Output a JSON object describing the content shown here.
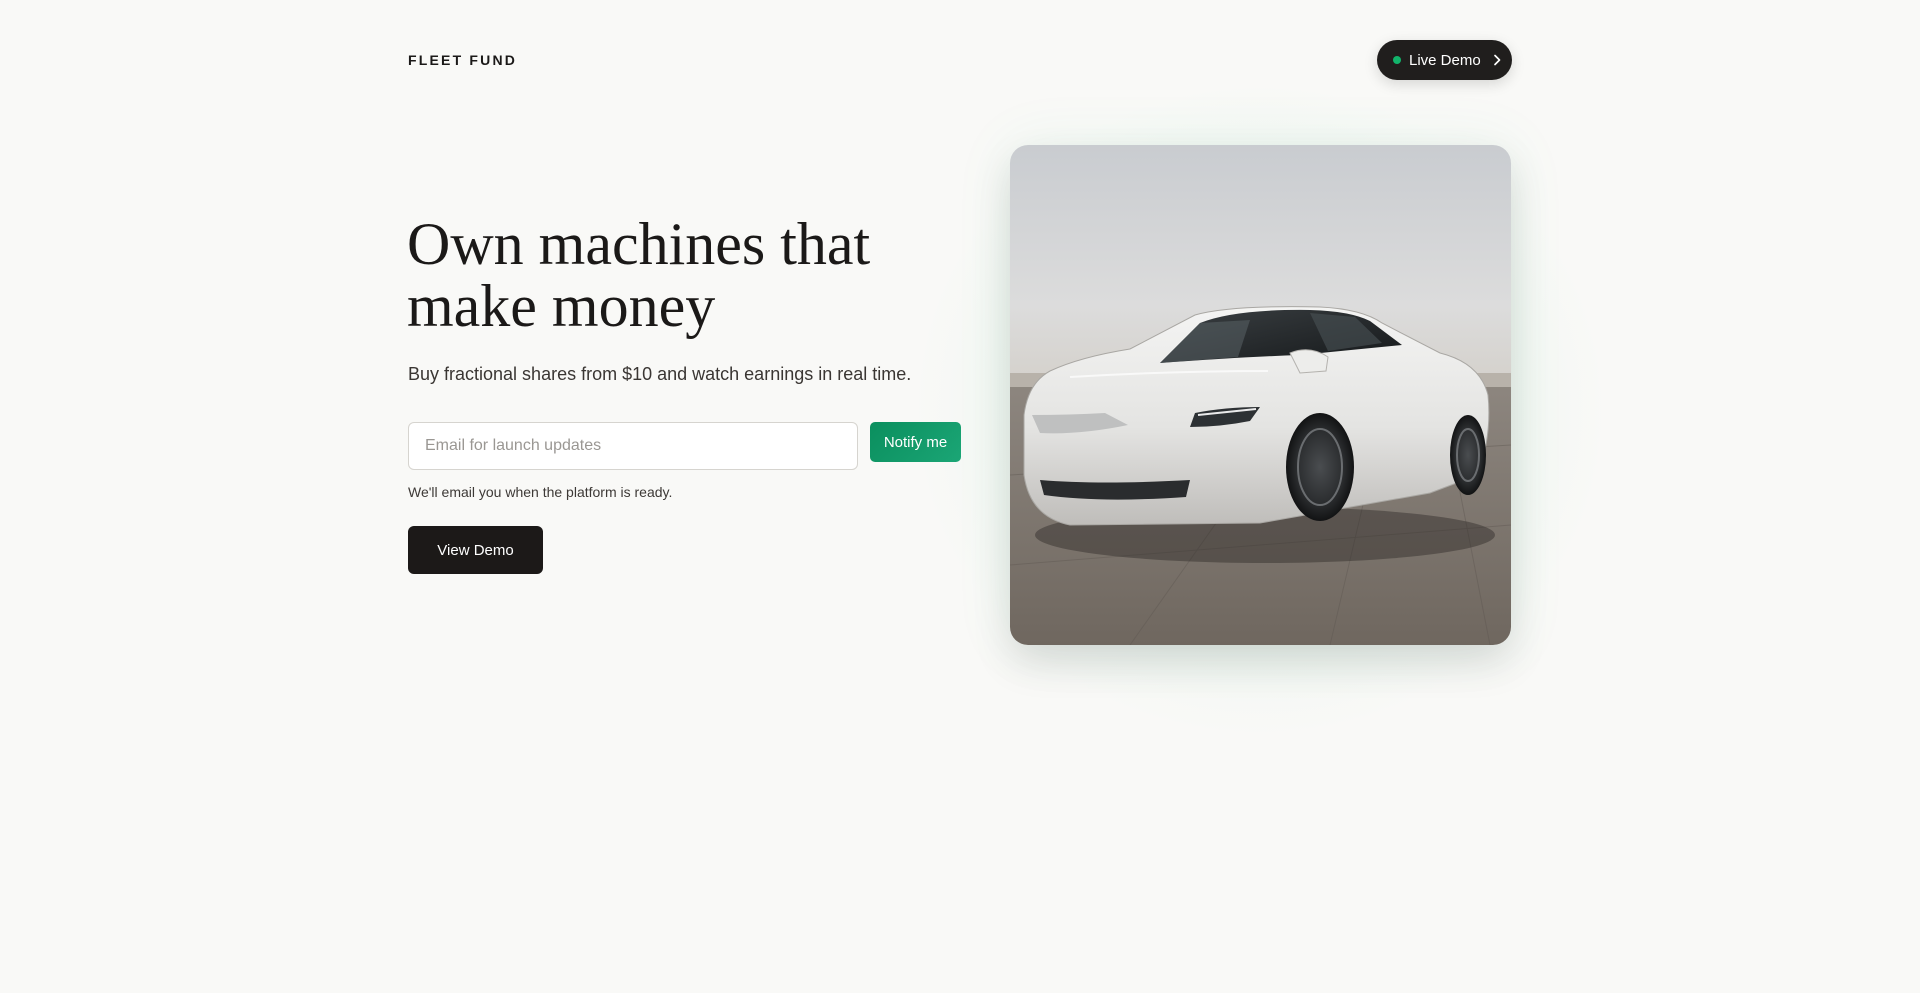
{
  "header": {
    "brand": "FLEET FUND",
    "live_demo": {
      "label": "Live Demo",
      "status_color": "#12b46b",
      "icon": "chevron-right-icon"
    }
  },
  "hero": {
    "title_line1": "Own machines that",
    "title_line2": "make money",
    "subtitle": "Buy fractional shares from $10 and watch earnings in real time.",
    "email": {
      "placeholder": "Email for launch updates",
      "value": ""
    },
    "notify_label": "Notify me",
    "helper": "We'll email you when the platform is ready.",
    "view_demo_label": "View Demo"
  },
  "media": {
    "image": "white-electric-sedan-photo"
  },
  "colors": {
    "background": "#f9f9f7",
    "accent": "#0f9a66",
    "dark": "#1c1918"
  }
}
